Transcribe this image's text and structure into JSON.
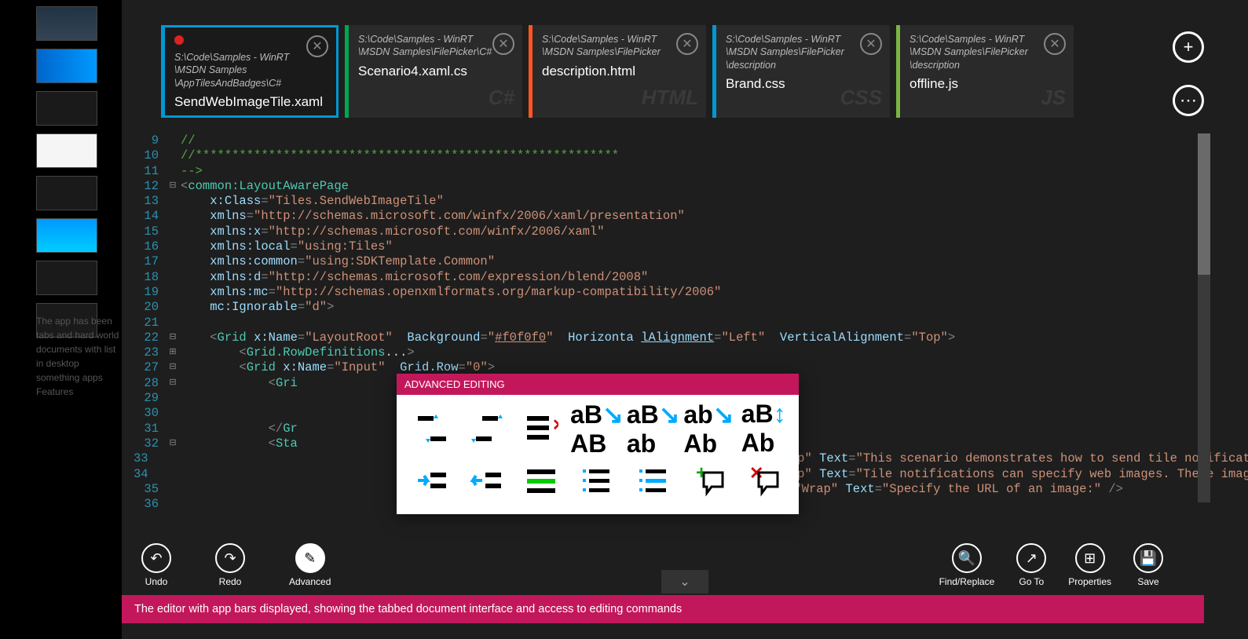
{
  "tabs": [
    {
      "path": "S:\\Code\\Samples - WinRT\n\\MSDN Samples\n\\AppTilesAndBadges\\C#",
      "file": "SendWebImageTile.xaml",
      "color": "#0098d4",
      "lang": "",
      "active": true,
      "dot": true
    },
    {
      "path": "S:\\Code\\Samples - WinRT\n\\MSDN Samples\\FilePicker\\C#",
      "file": "Scenario4.xaml.cs",
      "color": "#00a651",
      "lang": "C#"
    },
    {
      "path": "S:\\Code\\Samples - WinRT\n\\MSDN Samples\\FilePicker",
      "file": "description.html",
      "color": "#ff5722",
      "lang": "HTML"
    },
    {
      "path": "S:\\Code\\Samples - WinRT\n\\MSDN Samples\\FilePicker\n\\description",
      "file": "Brand.css",
      "color": "#0098d4",
      "lang": "CSS"
    },
    {
      "path": "S:\\Code\\Samples - WinRT\n\\MSDN Samples\\FilePicker\n\\description",
      "file": "offline.js",
      "color": "#7cb342",
      "lang": "JS"
    }
  ],
  "code": [
    {
      "n": 9,
      "fold": "",
      "html": "<span class='c-comment'>//</span>"
    },
    {
      "n": 10,
      "fold": "",
      "html": "<span class='c-comment'>//**********************************************************</span>"
    },
    {
      "n": 11,
      "fold": "",
      "html": "<span class='c-comment'>--&gt;</span>"
    },
    {
      "n": 12,
      "fold": "⊟",
      "html": "<span class='c-punc'>&lt;</span><span class='c-elem'>common:LayoutAwarePage</span>"
    },
    {
      "n": 13,
      "fold": "",
      "html": "    <span class='c-attr'>x:Class</span><span class='c-punc'>=</span><span class='c-str'>\"Tiles.SendWebImageTile\"</span>"
    },
    {
      "n": 14,
      "fold": "",
      "html": "    <span class='c-attr'>xmlns</span><span class='c-punc'>=</span><span class='c-str'>\"http://schemas.microsoft.com/winfx/2006/xaml/presentation\"</span>"
    },
    {
      "n": 15,
      "fold": "",
      "html": "    <span class='c-attr'>xmlns:x</span><span class='c-punc'>=</span><span class='c-str'>\"http://schemas.microsoft.com/winfx/2006/xaml\"</span>"
    },
    {
      "n": 16,
      "fold": "",
      "html": "    <span class='c-attr'>xmlns:local</span><span class='c-punc'>=</span><span class='c-str'>\"using:Tiles\"</span>"
    },
    {
      "n": 17,
      "fold": "",
      "html": "    <span class='c-attr'>xmlns:common</span><span class='c-punc'>=</span><span class='c-str'>\"using:SDKTemplate.Common\"</span>"
    },
    {
      "n": 18,
      "fold": "",
      "html": "    <span class='c-attr'>xmlns:d</span><span class='c-punc'>=</span><span class='c-str'>\"http://schemas.microsoft.com/expression/blend/2008\"</span>"
    },
    {
      "n": 19,
      "fold": "",
      "html": "    <span class='c-attr'>xmlns:mc</span><span class='c-punc'>=</span><span class='c-str'>\"http://schemas.openxmlformats.org/markup-compatibility/2006\"</span>"
    },
    {
      "n": 20,
      "fold": "",
      "html": "    <span class='c-attr'>mc:Ignorable</span><span class='c-punc'>=</span><span class='c-str'>\"d\"</span><span class='c-punc'>&gt;</span>"
    },
    {
      "n": 21,
      "fold": "",
      "html": ""
    },
    {
      "n": 22,
      "fold": "⊟",
      "html": "    <span class='c-punc'>&lt;</span><span class='c-elem'>Grid</span> <span class='c-attr'>x:Name</span><span class='c-punc'>=</span><span class='c-str'>\"LayoutRoot\"</span>  <span class='c-attr'>Background</span><span class='c-punc'>=</span><span class='c-str'>\"<u>#f0f0f0</u>\"</span>  <span class='c-attr'>Horizonta</span> <span class='c-attr'><u>lAlignment</u></span><span class='c-punc'>=</span><span class='c-str'>\"Left\"</span>  <span class='c-attr'>VerticalAlignment</span><span class='c-punc'>=</span><span class='c-str'>\"Top\"</span><span class='c-punc'>&gt;</span>"
    },
    {
      "n": 23,
      "fold": "⊞",
      "html": "        <span class='c-punc'>&lt;</span><span class='c-elem'>Grid.RowDefinitions</span><span class='c-txt'>...</span><span class='c-punc'>&gt;</span>"
    },
    {
      "n": 27,
      "fold": "⊟",
      "html": "        <span class='c-punc'>&lt;</span><span class='c-elem'>Grid</span> <span class='c-attr'>x:Name</span><span class='c-punc'>=</span><span class='c-str'>\"Input\"</span>  <span class='c-attr'>Grid.Row</span><span class='c-punc'>=</span><span class='c-str'>\"0\"</span><span class='c-punc'>&gt;</span>"
    },
    {
      "n": 28,
      "fold": "⊟",
      "html": "            <span class='c-punc'>&lt;</span><span class='c-elem'>Gri</span>"
    },
    {
      "n": 29,
      "fold": "",
      "html": ""
    },
    {
      "n": 30,
      "fold": "",
      "html": ""
    },
    {
      "n": 31,
      "fold": "",
      "html": "            <span class='c-punc'>&lt;/</span><span class='c-elem'>Gr</span>"
    },
    {
      "n": 32,
      "fold": "⊟",
      "html": "            <span class='c-punc'>&lt;</span><span class='c-elem'>Sta</span>"
    },
    {
      "n": 33,
      "fold": "",
      "html": "                                                                                <span class='c-attr'>ing</span><span class='c-punc'>=</span><span class='c-str'>\"Wrap\"</span> <span class='c-attr'>Text</span><span class='c-punc'>=</span><span class='c-str'>\"This scenario demonstrates how to send tile notificat</span>"
    },
    {
      "n": 34,
      "fold": "",
      "html": "                                                                                <span class='c-attr'>ing</span><span class='c-punc'>=</span><span class='c-str'>\"Wrap\"</span> <span class='c-attr'>Text</span><span class='c-punc'>=</span><span class='c-str'>\"Tile notifications can specify web images. These imag</span>"
    },
    {
      "n": 35,
      "fold": "",
      "html": "                                                                                <span class='c-attr'>ing</span><span class='c-punc'>=</span><span class='c-str'>\"Wrap\"</span> <span class='c-attr'>Text</span><span class='c-punc'>=</span><span class='c-str'>\"Specify the URL of an image:\"</span> <span class='c-punc'>/&gt;</span>"
    },
    {
      "n": 36,
      "fold": "",
      "html": ""
    }
  ],
  "popup": {
    "title": "ADVANCED EDITING"
  },
  "appbar": {
    "left": [
      {
        "label": "Undo",
        "icon": "↶"
      },
      {
        "label": "Redo",
        "icon": "↷"
      },
      {
        "label": "Advanced",
        "icon": "✎",
        "active": true
      }
    ],
    "right": [
      {
        "label": "Find/Replace",
        "icon": "🔍"
      },
      {
        "label": "Go To",
        "icon": "↗"
      },
      {
        "label": "Properties",
        "icon": "⊞"
      },
      {
        "label": "Save",
        "icon": "💾"
      }
    ]
  },
  "caption": "The editor with app bars displayed, showing the tabbed document interface and access to editing commands",
  "bgtext": "The app has been\ntabs and hard world\ndocuments with\nlist in desktop\nsomething apps\n\nFeatures"
}
